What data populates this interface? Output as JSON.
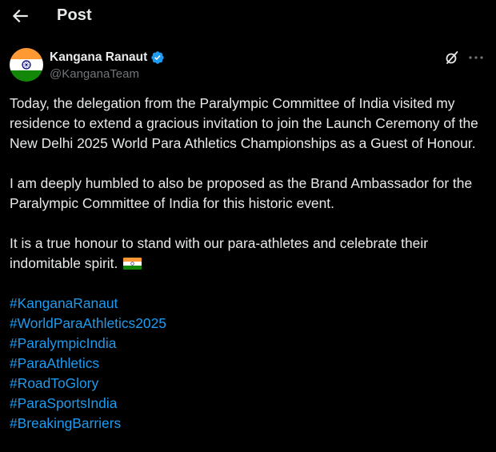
{
  "header": {
    "title": "Post",
    "back_icon": "arrow-left-icon"
  },
  "author": {
    "name": "Kangana Ranaut",
    "handle": "@KanganaTeam",
    "verified_icon": "verified-badge-icon",
    "avatar_icon": "india-flag-avatar"
  },
  "actions": {
    "grok_icon": "grok-icon",
    "more_icon": "more-horizontal-icon"
  },
  "post": {
    "paragraphs": [
      "Today, the delegation from the Paralympic Committee of India visited my residence to extend a gracious invitation to join the Launch Ceremony of the New Delhi 2025 World Para Athletics Championships as a Guest of Honour.",
      "I am deeply humbled to also be proposed as the Brand Ambassador for the Paralympic Committee of India for this historic event.",
      "It is a true honour to stand with our para-athletes and celebrate their indomitable spirit."
    ],
    "emoji": "india-flag-emoji",
    "hashtags": [
      "#KanganaRanaut",
      "#WorldParaAthletics2025",
      "#ParalympicIndia",
      "#ParaAthletics",
      "#RoadToGlory",
      "#ParaSportsIndia",
      "#BreakingBarriers"
    ]
  },
  "colors": {
    "background": "#000000",
    "text": "#e7e9ea",
    "secondary_text": "#71767b",
    "link": "#1d9bf0",
    "verified": "#1d9bf0"
  }
}
